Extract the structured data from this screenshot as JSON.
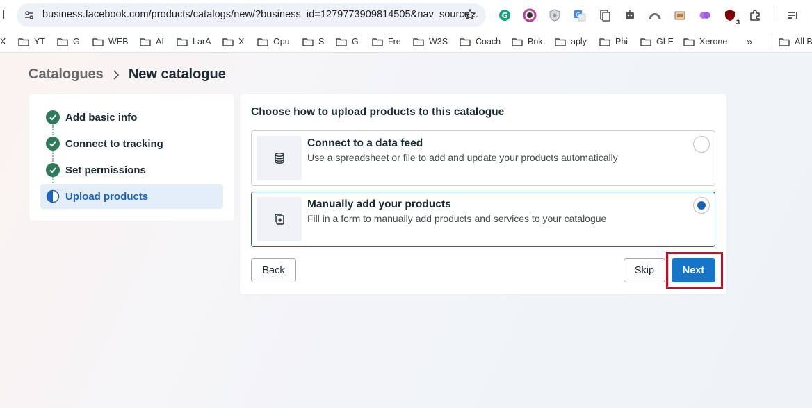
{
  "browser": {
    "url": "business.facebook.com/products/catalogs/new/?business_id=1279773909814505&nav_source...",
    "extensions": [
      "grammarly-icon",
      "color-picker-icon",
      "shield-icon",
      "translate-icon",
      "reader-icon",
      "robot-icon",
      "arch-icon",
      "image-icon",
      "brain-icon",
      "ublock-icon",
      "puzzle-icon",
      "playlist-icon"
    ],
    "extension_badge": "3",
    "bookmarks": [
      "X",
      "YT",
      "G",
      "WEB",
      "AI",
      "LarA",
      "X",
      "Opu",
      "S",
      "G",
      "Fre",
      "W3S",
      "Coach",
      "Bnk",
      "aply",
      "Phi",
      "GLE",
      "Xerone"
    ],
    "bookmarks_overflow": "»",
    "all_bookmarks": "All B"
  },
  "breadcrumb": {
    "root": "Catalogues",
    "current": "New catalogue"
  },
  "steps": [
    {
      "label": "Add basic info",
      "state": "done"
    },
    {
      "label": "Connect to tracking",
      "state": "done"
    },
    {
      "label": "Set permissions",
      "state": "done"
    },
    {
      "label": "Upload products",
      "state": "active"
    }
  ],
  "upload": {
    "title": "Choose how to upload products to this catalogue",
    "options": [
      {
        "title": "Connect to a data feed",
        "description": "Use a spreadsheet or file to add and update your products automatically",
        "icon": "database-icon",
        "selected": false
      },
      {
        "title": "Manually add your products",
        "description": "Fill in a form to manually add products and services to your catalogue",
        "icon": "add-product-icon",
        "selected": true
      }
    ]
  },
  "buttons": {
    "back": "Back",
    "skip": "Skip",
    "next": "Next"
  },
  "colors": {
    "primary": "#1775c7",
    "success": "#2f7a5b",
    "highlight": "#e0001a",
    "active_step_bg": "#e4eef8"
  }
}
